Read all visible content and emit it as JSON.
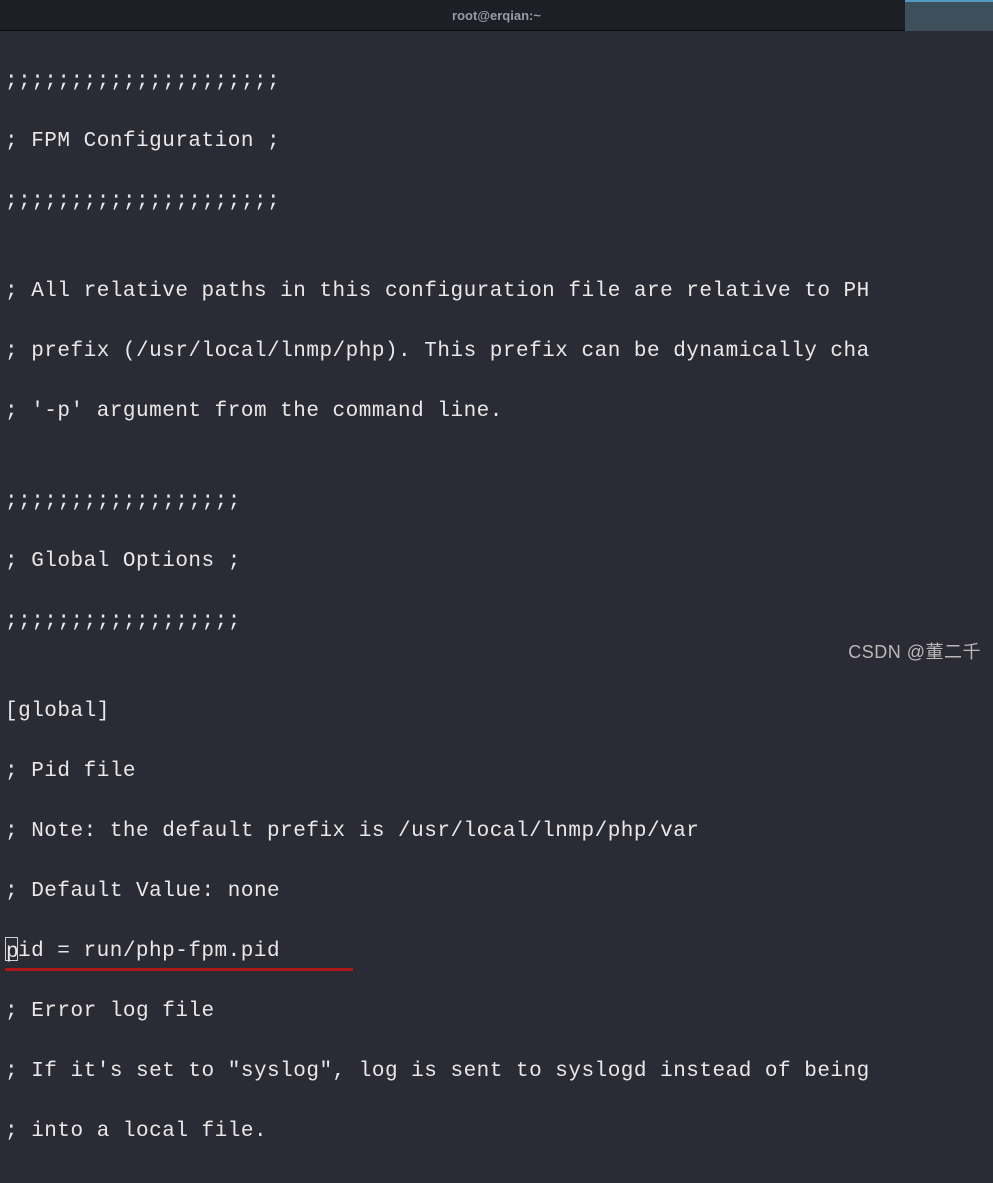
{
  "titlebar": {
    "title": "root@erqian:~",
    "close": "×"
  },
  "config": {
    "l01": ";;;;;;;;;;;;;;;;;;;;;",
    "l02": "; FPM Configuration ;",
    "l03": ";;;;;;;;;;;;;;;;;;;;;",
    "l04": "",
    "l05": "; All relative paths in this configuration file are relative to PH",
    "l06": "; prefix (/usr/local/lnmp/php). This prefix can be dynamically cha",
    "l07": "; '-p' argument from the command line.",
    "l08": "",
    "l09": ";;;;;;;;;;;;;;;;;;",
    "l10": "; Global Options ;",
    "l11": ";;;;;;;;;;;;;;;;;;",
    "l12": "",
    "l13": "[global]",
    "l14": "; Pid file",
    "l15": "; Note: the default prefix is /usr/local/lnmp/php/var",
    "l16": "; Default Value: none",
    "l17_rest": "id = run/php-fpm.pid",
    "l18": "",
    "l19": "; Error log file",
    "l20": "; If it's set to \"syslog\", log is sent to syslogd instead of being",
    "l21": "; into a local file."
  },
  "watermark": "CSDN @董二千"
}
